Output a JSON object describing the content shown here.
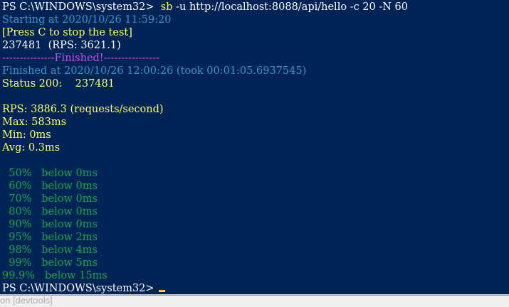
{
  "terminal": {
    "prompt": "PS C:\\WINDOWS\\system32>",
    "command_name": "sb",
    "command_args": "-u http://localhost:8088/api/hello -c 20 -N 60",
    "starting": "Starting at 2020/10/26 11:59:20",
    "press_c": "[Press C to stop the test]",
    "progress": "237481  (RPS: 3621.1)",
    "finished_banner": "---------------Finished!----------------",
    "finished_at": "Finished at 2020/10/26 12:00:26 (took 00:01:05.6937545)",
    "status_line": "Status 200:    237481",
    "rps": "RPS: 3886.3 (requests/second)",
    "max": "Max: 583ms",
    "min": "Min: 0ms",
    "avg": "Avg: 0.3ms",
    "percentiles": [
      "  50%   below 0ms",
      "  60%   below 0ms",
      "  70%   below 0ms",
      "  80%   below 0ms",
      "  90%   below 0ms",
      "  95%   below 2ms",
      "  98%   below 4ms",
      "  99%   below 5ms",
      "99.9%   below 15ms"
    ],
    "final_prompt": "PS C:\\WINDOWS\\system32>"
  },
  "statusbar": {
    "text": "on [devtools]"
  },
  "colors": {
    "background": "#012456",
    "prompt": "#ffffff",
    "command": "#ffff66",
    "info": "#3a96c8",
    "banner": "#c94ee6",
    "percentiles": "#17a74a",
    "cursor": "#ffcc33"
  }
}
